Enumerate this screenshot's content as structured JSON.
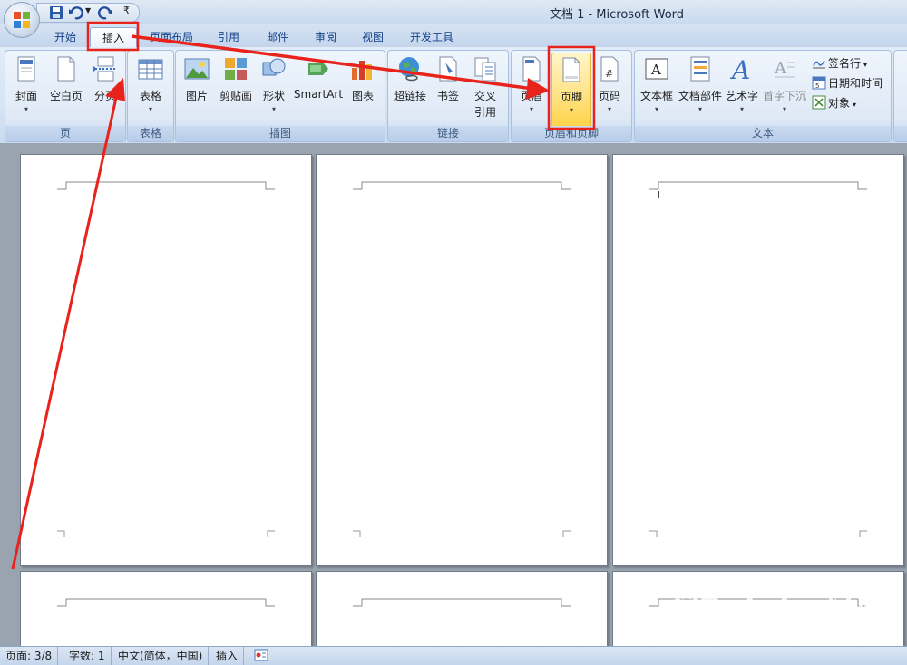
{
  "window": {
    "title": "文档 1 - Microsoft Word"
  },
  "tabs": [
    {
      "id": "home",
      "label": "开始"
    },
    {
      "id": "insert",
      "label": "插入",
      "active": true
    },
    {
      "id": "layout",
      "label": "页面布局"
    },
    {
      "id": "references",
      "label": "引用"
    },
    {
      "id": "mailings",
      "label": "邮件"
    },
    {
      "id": "review",
      "label": "审阅"
    },
    {
      "id": "view",
      "label": "视图"
    },
    {
      "id": "developer",
      "label": "开发工具"
    }
  ],
  "ribbon": {
    "groups": {
      "pages": {
        "label": "页",
        "buttons": {
          "cover": "封面",
          "blank": "空白页",
          "break": "分页"
        }
      },
      "tables": {
        "label": "表格",
        "buttons": {
          "table": "表格"
        }
      },
      "illustrations": {
        "label": "插图",
        "buttons": {
          "picture": "图片",
          "clipart": "剪贴画",
          "shapes": "形状",
          "smartart": "SmartArt",
          "chart": "图表"
        }
      },
      "links": {
        "label": "链接",
        "buttons": {
          "hyperlink": "超链接",
          "bookmark": "书签",
          "crossref_1": "交叉",
          "crossref_2": "引用"
        }
      },
      "header_footer": {
        "label": "页眉和页脚",
        "buttons": {
          "header": "页眉",
          "footer": "页脚",
          "pagenum": "页码"
        }
      },
      "text": {
        "label": "文本",
        "buttons": {
          "textbox": "文本框",
          "quickparts": "文档部件",
          "wordart": "艺术字",
          "dropcap": "首字下沉"
        },
        "small": {
          "signature": "签名行",
          "datetime": "日期和时间",
          "object": "对象"
        }
      }
    }
  },
  "statusbar": {
    "page": "页面: 3/8",
    "words": "字数: 1",
    "language": "中文(简体，中国)",
    "mode": "插入"
  },
  "watermark": {
    "brand": "Bai du 经验",
    "url": "jingyan.baidu.com"
  },
  "colors": {
    "annotation": "#e8231c",
    "highlight": "#ffd040"
  }
}
